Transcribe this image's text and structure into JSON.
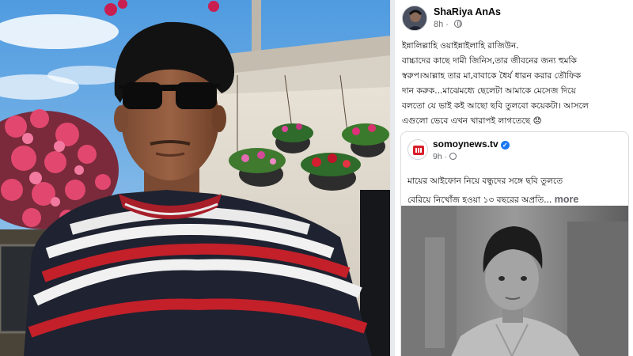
{
  "post": {
    "author": "ShaRiya AnAs",
    "time": "8h",
    "privacy_icon": "globe-icon",
    "text_lines": [
      "ইন্নালিল্লাহি ওয়াইন্নাইলাহি রাজিউন.",
      "বাচ্চাদের কাছে দামী জিনিস,তার জীবনের জন্য হুমকি",
      "স্বরুপ।আল্লাহ তার মা,বাবাকে ধৈর্য ধারন করার তৌফিক",
      "দান করুক...মাঝেমধ্যে ছেলেটা আমাকে মেসেজ দিয়ে",
      "বলতো যে ভাই কই আছো ছবি তুলবো কয়েকটা। আসলে",
      "এগুলো ভেবে এখন খারাপই লাগতেছে 😞"
    ]
  },
  "shared": {
    "page_name": "somoynews.tv",
    "time": "9h",
    "privacy_icon": "globe-icon",
    "headline_line1": "মায়ের আইফোন নিয়ে বন্ধুদের সঙ্গে ছবি তুলতে",
    "headline_line2": "বেরিয়ে নিখোঁজ হওয়া ১৩ বছরের অপ্রতি...",
    "more_label": "more"
  },
  "colors": {
    "fb_text": "#050505",
    "fb_secondary": "#65676b",
    "verified_blue": "#1877f2",
    "divider": "#e7e9ed"
  }
}
